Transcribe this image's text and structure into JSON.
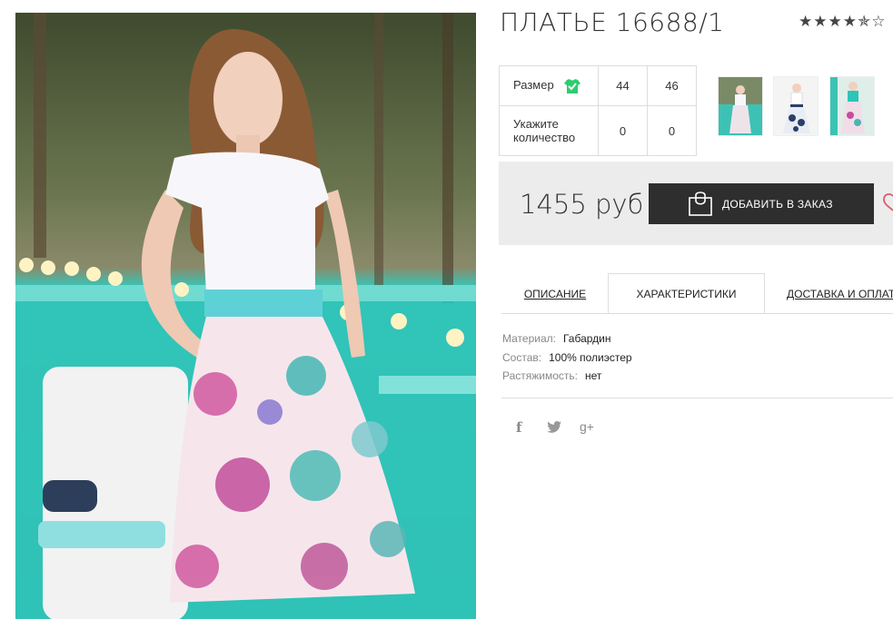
{
  "product": {
    "title": "ПЛАТЬЕ 16688/1",
    "rating_stars": "★★★★✯☆"
  },
  "size_table": {
    "size_label": "Размер",
    "qty_label": "Укажите количество",
    "sizes": [
      "44",
      "46"
    ],
    "quantities": [
      "0",
      "0"
    ],
    "icon": "tshirt-check-icon"
  },
  "price": {
    "value": "1455 руб",
    "order_button": "ДОБАВИТЬ В ЗАКАЗ"
  },
  "tabs": {
    "description": "ОПИСАНИЕ",
    "characteristics": "ХАРАКТЕРИСТИКИ",
    "delivery": "ДОСТАВКА И ОПЛАТА"
  },
  "specs": {
    "material_key": "Материал:",
    "material_val": "Габардин",
    "composition_key": "Состав:",
    "composition_val": "100% полиэстер",
    "stretch_key": "Растяжимость:",
    "stretch_val": "нет"
  },
  "social": {
    "facebook": "f",
    "twitter": "t",
    "google": "g+"
  },
  "colors": {
    "accent_green": "#2ecc71",
    "button_dark": "#2e2e2e",
    "heart_red": "#e05a6a"
  }
}
